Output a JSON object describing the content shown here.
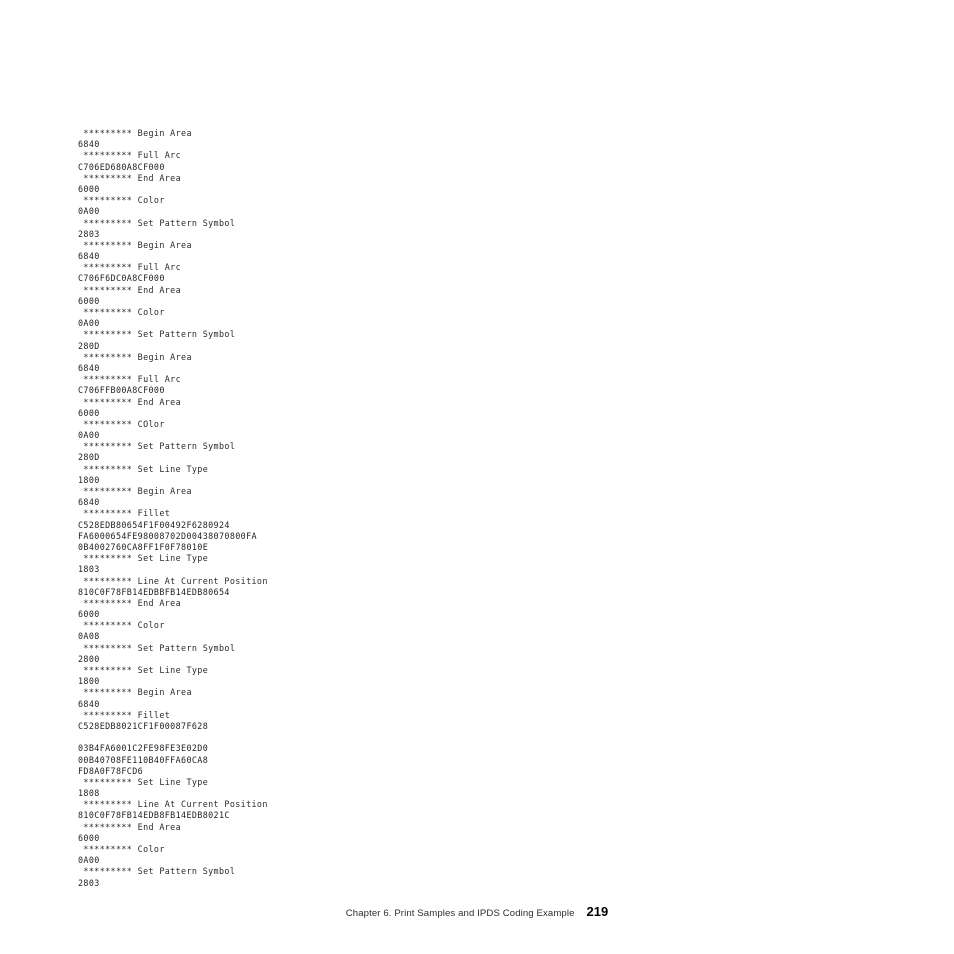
{
  "document": {
    "page_number": "219",
    "footer_chapter": "Chapter 6. Print Samples and IPDS Coding Example"
  },
  "trace": {
    "lines": [
      {
        "kind": "cmd",
        "text": " ********* Begin Area"
      },
      {
        "kind": "hex",
        "text": "6840"
      },
      {
        "kind": "cmd",
        "text": " ********* Full Arc"
      },
      {
        "kind": "hex",
        "text": "C706ED680A8CF000"
      },
      {
        "kind": "cmd",
        "text": " ********* End Area"
      },
      {
        "kind": "hex",
        "text": "6000"
      },
      {
        "kind": "cmd",
        "text": " ********* Color"
      },
      {
        "kind": "hex",
        "text": "0A00"
      },
      {
        "kind": "cmd",
        "text": " ********* Set Pattern Symbol"
      },
      {
        "kind": "hex",
        "text": "2803"
      },
      {
        "kind": "cmd",
        "text": " ********* Begin Area"
      },
      {
        "kind": "hex",
        "text": "6840"
      },
      {
        "kind": "cmd",
        "text": " ********* Full Arc"
      },
      {
        "kind": "hex",
        "text": "C706F6DC0A8CF000"
      },
      {
        "kind": "cmd",
        "text": " ********* End Area"
      },
      {
        "kind": "hex",
        "text": "6000"
      },
      {
        "kind": "cmd",
        "text": " ********* Color"
      },
      {
        "kind": "hex",
        "text": "0A00"
      },
      {
        "kind": "cmd",
        "text": " ********* Set Pattern Symbol"
      },
      {
        "kind": "hex",
        "text": "280D"
      },
      {
        "kind": "cmd",
        "text": " ********* Begin Area"
      },
      {
        "kind": "hex",
        "text": "6840"
      },
      {
        "kind": "cmd",
        "text": " ********* Full Arc"
      },
      {
        "kind": "hex",
        "text": "C706FFB00A8CF000"
      },
      {
        "kind": "cmd",
        "text": " ********* End Area"
      },
      {
        "kind": "hex",
        "text": "6000"
      },
      {
        "kind": "cmd",
        "text": " ********* COlor"
      },
      {
        "kind": "hex",
        "text": "0A00"
      },
      {
        "kind": "cmd",
        "text": " ********* Set Pattern Symbol"
      },
      {
        "kind": "hex",
        "text": "280D"
      },
      {
        "kind": "cmd",
        "text": " ********* Set Line Type"
      },
      {
        "kind": "hex",
        "text": "1800"
      },
      {
        "kind": "cmd",
        "text": " ********* Begin Area"
      },
      {
        "kind": "hex",
        "text": "6840"
      },
      {
        "kind": "cmd",
        "text": " ********* Fillet"
      },
      {
        "kind": "hex",
        "text": "C528EDB80654F1F00492F6280924"
      },
      {
        "kind": "hex",
        "text": "FA6000654FE98008702D00438070800FA"
      },
      {
        "kind": "hex",
        "text": "0B4002760CA8FF1F0F78010E"
      },
      {
        "kind": "cmd",
        "text": " ********* Set Line Type"
      },
      {
        "kind": "hex",
        "text": "1803"
      },
      {
        "kind": "cmd",
        "text": " ********* Line At Current Position"
      },
      {
        "kind": "hex",
        "text": "810C0F78FB14EDBBFB14EDB80654"
      },
      {
        "kind": "cmd",
        "text": " ********* End Area"
      },
      {
        "kind": "hex",
        "text": "6000"
      },
      {
        "kind": "cmd",
        "text": " ********* Color"
      },
      {
        "kind": "hex",
        "text": "0A08"
      },
      {
        "kind": "cmd",
        "text": " ********* Set Pattern Symbol"
      },
      {
        "kind": "hex",
        "text": "2800"
      },
      {
        "kind": "cmd",
        "text": " ********* Set Line Type"
      },
      {
        "kind": "hex",
        "text": "1800"
      },
      {
        "kind": "cmd",
        "text": " ********* Begin Area"
      },
      {
        "kind": "hex",
        "text": "6840"
      },
      {
        "kind": "cmd",
        "text": " ********* Fillet"
      },
      {
        "kind": "hex",
        "text": "C528EDB8021CF1F00087F628"
      },
      {
        "kind": "blank",
        "text": ""
      },
      {
        "kind": "hex",
        "text": "03B4FA6001C2FE98FE3E02D0"
      },
      {
        "kind": "hex",
        "text": "00B40708FE110B40FFA60CA8"
      },
      {
        "kind": "hex",
        "text": "FD8A0F78FCD6"
      },
      {
        "kind": "cmd",
        "text": " ********* Set Line Type"
      },
      {
        "kind": "hex",
        "text": "1808"
      },
      {
        "kind": "cmd",
        "text": " ********* Line At Current Position"
      },
      {
        "kind": "hex",
        "text": "810C0F78FB14EDB8FB14EDB8021C"
      },
      {
        "kind": "cmd",
        "text": " ********* End Area"
      },
      {
        "kind": "hex",
        "text": "6000"
      },
      {
        "kind": "cmd",
        "text": " ********* Color"
      },
      {
        "kind": "hex",
        "text": "0A00"
      },
      {
        "kind": "cmd",
        "text": " ********* Set Pattern Symbol"
      },
      {
        "kind": "hex",
        "text": "2803"
      }
    ]
  }
}
